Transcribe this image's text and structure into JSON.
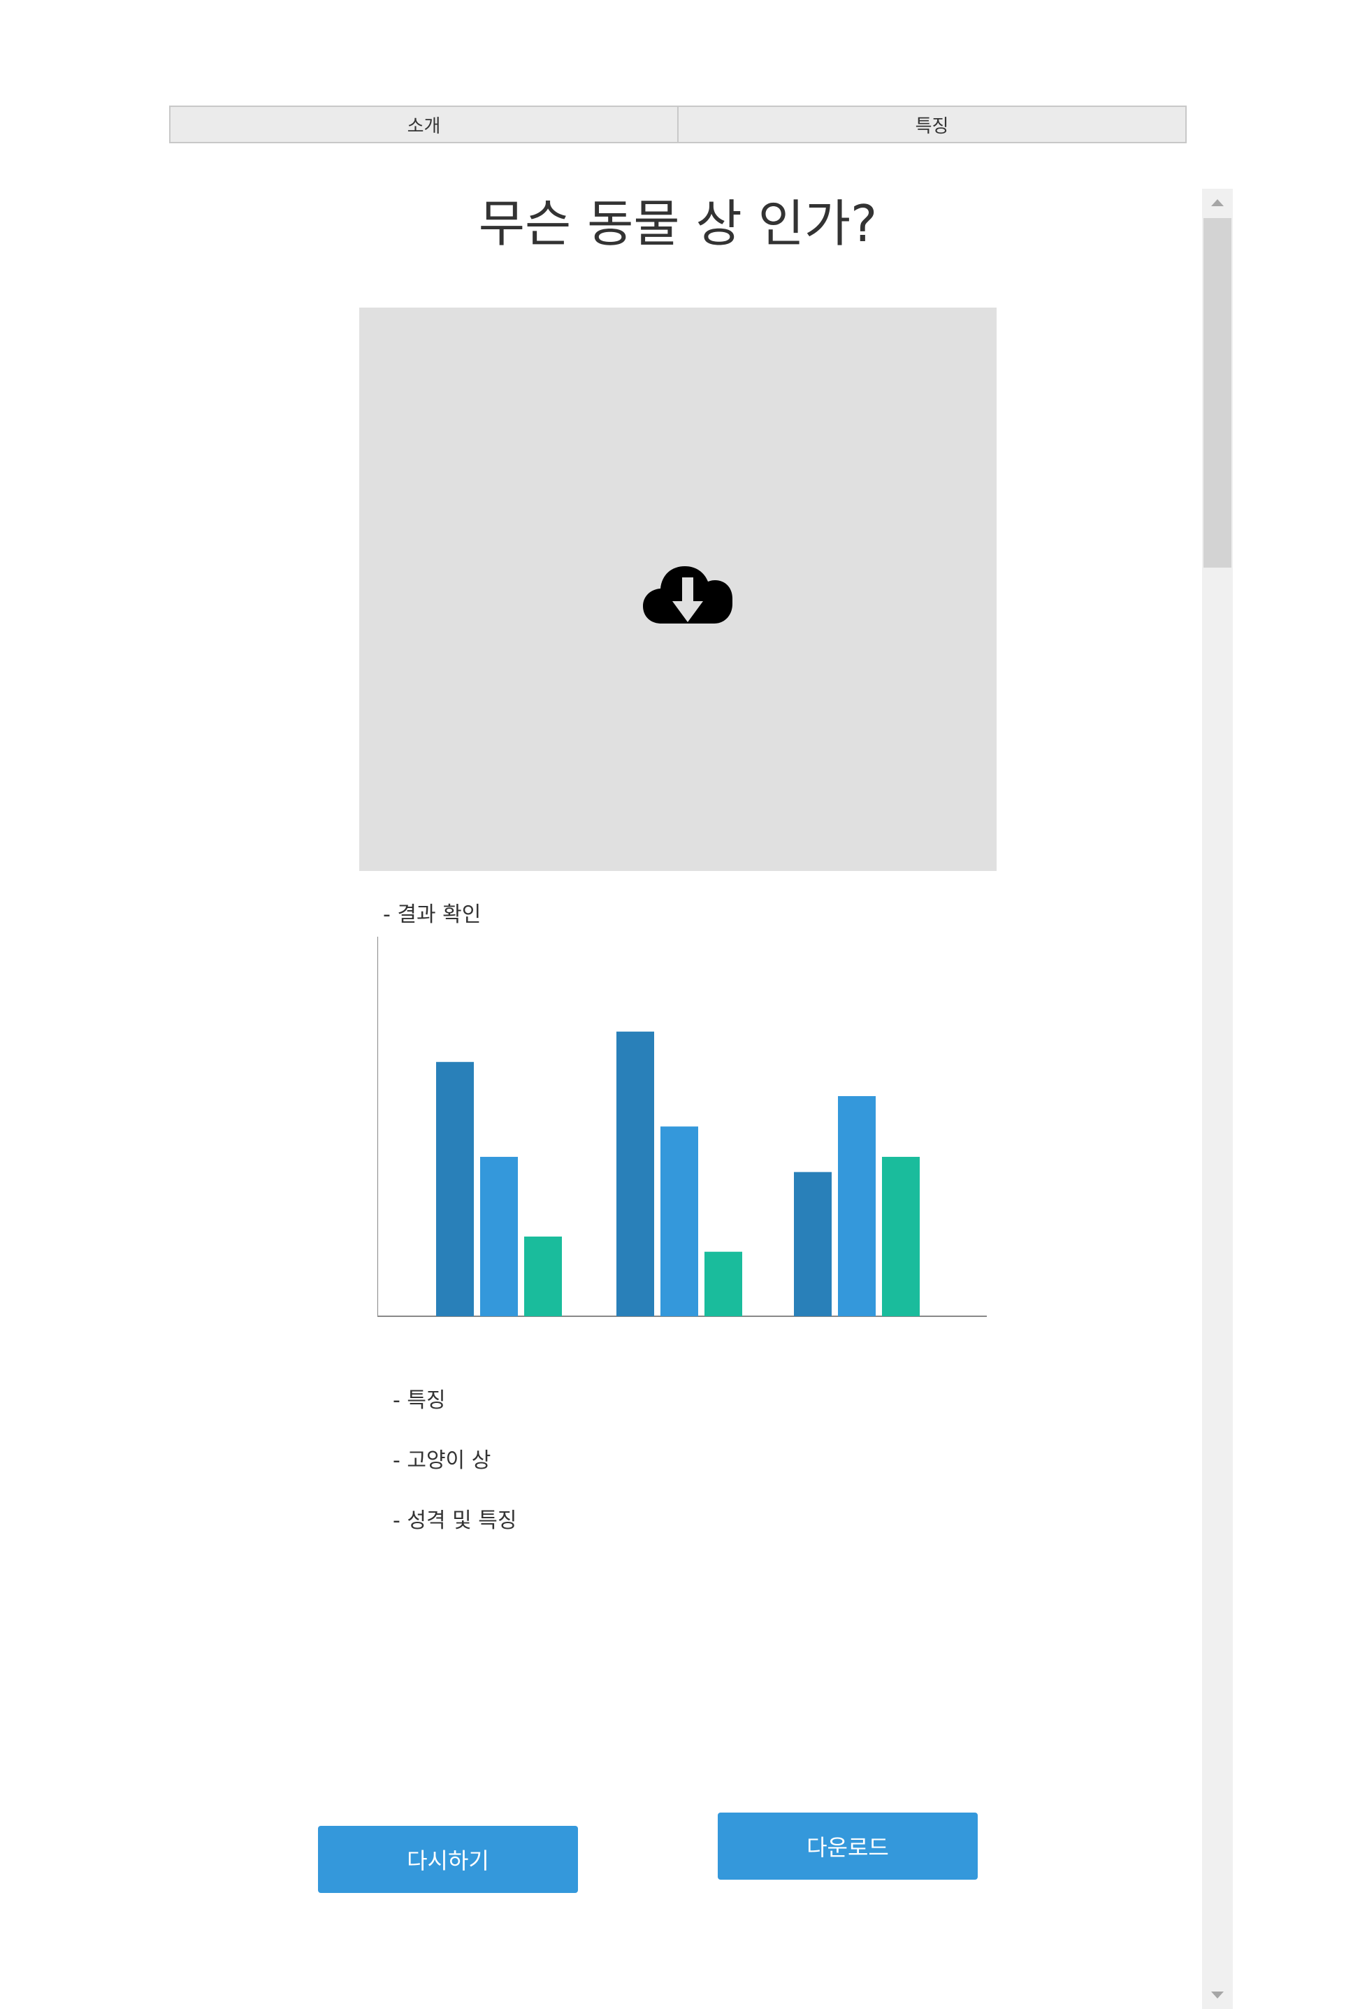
{
  "tabs": [
    {
      "label": "소개"
    },
    {
      "label": "특징"
    }
  ],
  "title": "무슨 동물 상 인가?",
  "upload": {
    "icon": "cloud-download-icon"
  },
  "result_label": "- 결과 확인",
  "chart_data": {
    "type": "bar",
    "categories": [
      "",
      "",
      ""
    ],
    "ylim": [
      0,
      100
    ],
    "grid": false,
    "legend": "none",
    "series": [
      {
        "color": "#2980b9",
        "values": [
          67,
          75,
          38
        ]
      },
      {
        "color": "#3498db",
        "values": [
          42,
          50,
          58
        ]
      },
      {
        "color": "#1abc9c",
        "values": [
          21,
          17,
          42
        ]
      }
    ]
  },
  "features": {
    "heading": "- 특징",
    "type_label": "- 고양이 상",
    "personality_label": "- 성격 및 특징"
  },
  "buttons": {
    "retry": "다시하기",
    "download": "다운로드"
  },
  "colors": {
    "accent": "#3498db",
    "upload_bg": "#e0e0e0"
  }
}
